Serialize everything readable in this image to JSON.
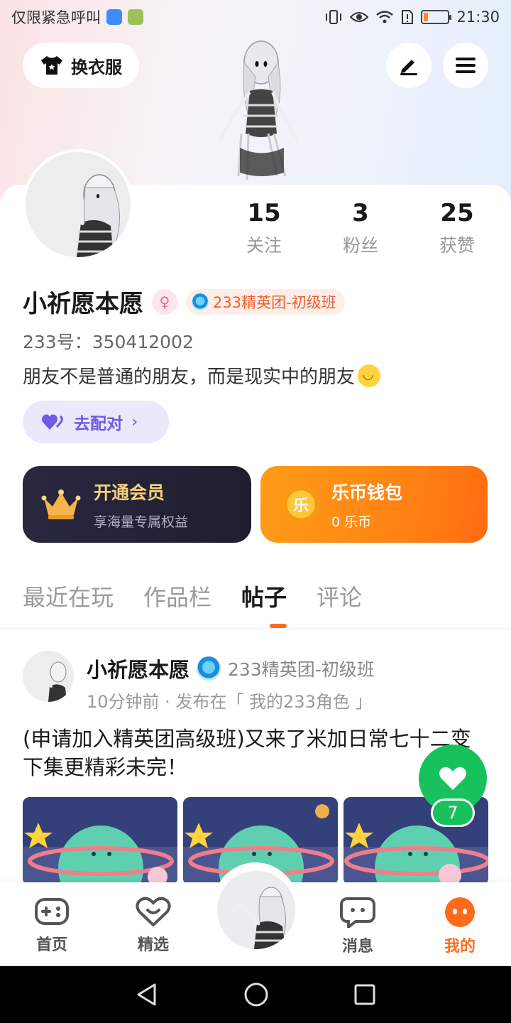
{
  "status_bar": {
    "carrier_text": "仅限紧急呼叫",
    "time": "21:30",
    "battery_level": 0.2
  },
  "header": {
    "outfit_button": "换衣服",
    "edit_icon": "pencil-icon",
    "menu_icon": "menu-icon"
  },
  "profile": {
    "stats": [
      {
        "value": "15",
        "label": "关注"
      },
      {
        "value": "3",
        "label": "粉丝"
      },
      {
        "value": "25",
        "label": "获赞"
      }
    ],
    "name": "小祈愿本愿",
    "gender_icon": "female-icon",
    "badge": "233精英团-初级班",
    "uid": "233号：350412002",
    "bio": "朋友不是普通的朋友，而是现实中的朋友",
    "match_button": "去配对"
  },
  "cards": {
    "vip": {
      "title": "开通会员",
      "subtitle": "享海量专属权益"
    },
    "wallet": {
      "title": "乐币钱包",
      "subtitle": "0 乐币",
      "coin_char": "乐"
    }
  },
  "tabs": [
    {
      "label": "最近在玩",
      "active": false
    },
    {
      "label": "作品栏",
      "active": false
    },
    {
      "label": "帖子",
      "active": true
    },
    {
      "label": "评论",
      "active": false
    }
  ],
  "post": {
    "author": "小祈愿本愿",
    "author_badge": "233精英团-初级班",
    "meta": "10分钟前 · 发布在「 我的233角色 」",
    "text": "(申请加入精英团高级班)又来了米加日常七十二变下集更精彩未完！",
    "like_count": "7"
  },
  "bottom_nav": [
    {
      "label": "首页",
      "icon": "gamepad-icon",
      "active": false
    },
    {
      "label": "精选",
      "icon": "heart-smile-icon",
      "active": false
    },
    {
      "label": "消息",
      "icon": "chat-icon",
      "active": false
    },
    {
      "label": "我的",
      "icon": "face-icon",
      "active": true
    }
  ],
  "colors": {
    "accent": "#ff6b1a",
    "like_green": "#17c25d",
    "match_purple": "#6c5ce7",
    "vip_gold": "#f6cf7a"
  }
}
